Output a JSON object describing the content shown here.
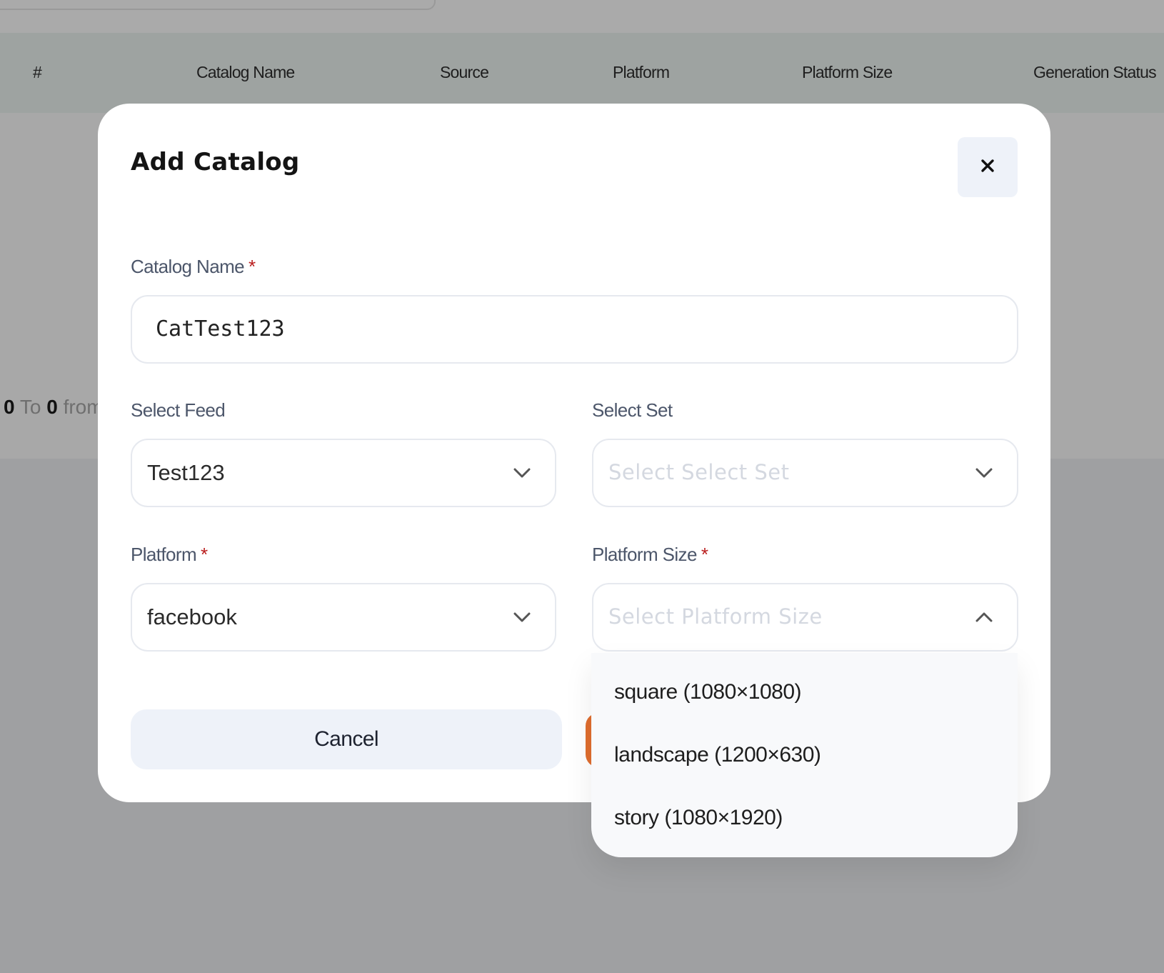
{
  "background_table": {
    "headers": [
      "#",
      "Catalog Name",
      "Source",
      "Platform",
      "Platform Size",
      "Generation Status"
    ],
    "pagination": {
      "from": "0",
      "to_word": "To",
      "to": "0",
      "from_word": "from"
    }
  },
  "modal": {
    "title": "Add Catalog",
    "close_label": "×",
    "catalog_name": {
      "label": "Catalog Name",
      "required": "*",
      "value": "CatTest123"
    },
    "select_feed": {
      "label": "Select Feed",
      "value": "Test123"
    },
    "select_set": {
      "label": "Select Set",
      "placeholder": "Select Select Set"
    },
    "platform": {
      "label": "Platform",
      "required": "*",
      "value": "facebook"
    },
    "platform_size": {
      "label": "Platform Size",
      "required": "*",
      "placeholder": "Select Platform Size",
      "options": [
        "square (1080×1080)",
        "landscape (1200×630)",
        "story (1080×1920)"
      ]
    },
    "cancel_label": "Cancel"
  },
  "colors": {
    "accent": "#e06d2e",
    "required": "#b91c1c",
    "label": "#4c566a",
    "button_bg": "#eef2f9"
  },
  "icons": {
    "close": "close-icon",
    "dropdown_closed": "chevron-down-icon",
    "dropdown_open": "chevron-up-icon"
  }
}
